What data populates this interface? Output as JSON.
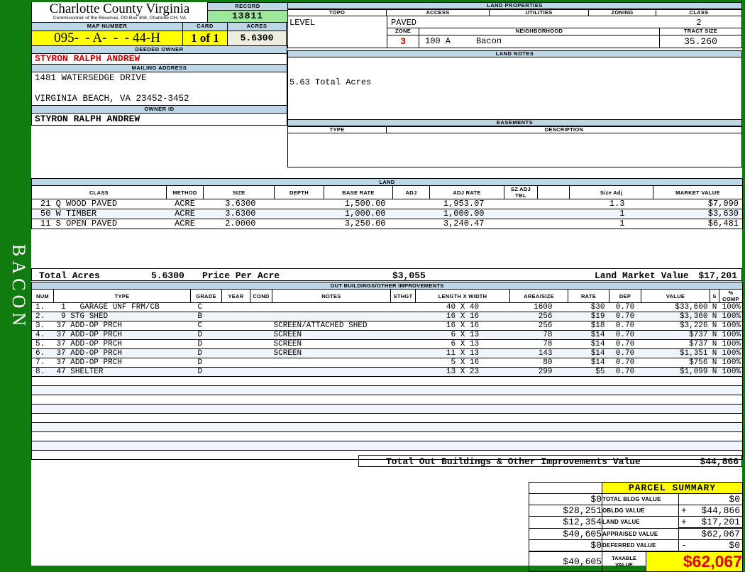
{
  "sidebar": {
    "label": "BACON"
  },
  "header": {
    "county": "Charlotte County Virginia",
    "commissioner": "Commissioner of the Revenue, PO Box 308, Charlotte CH, VA",
    "record_label": "RECORD",
    "record_value": "13811",
    "map_number_label": "MAP NUMBER",
    "map_number": "095-  - A-  -  - 44-H",
    "card_label": "CARD",
    "card": "1 of 1",
    "acres_label": "ACRES",
    "acres": "5.6300"
  },
  "owner": {
    "deeded_owner_label": "DEEDED OWNER",
    "deeded_owner": "STYRON RALPH ANDREW",
    "mailing_address_label": "MAILING ADDRESS",
    "address_line1": "1481 WATERSEDGE DRIVE",
    "address_line2": "VIRGINIA BEACH, VA 23452-3452",
    "owner_id_label": "OWNER ID",
    "owner_id": "STYRON RALPH ANDREW"
  },
  "land_properties": {
    "title": "LAND PROPERTIES",
    "topo_label": "TOPO",
    "topo": "LEVEL",
    "access_label": "ACCESS",
    "access": "PAVED",
    "utilities_label": "UTILITIES",
    "zoning_label": "ZONING",
    "class_label": "CLASS",
    "class": "2",
    "zone_label": "ZONE",
    "zone": "3",
    "neighborhood_label": "NEIGHBORHOOD",
    "neighborhood": "100 A     Bacon",
    "tract_size_label": "TRACT SIZE",
    "tract_size": "35.260"
  },
  "land_notes": {
    "title": "LAND NOTES",
    "note": "5.63 Total Acres"
  },
  "easements": {
    "title": "EASEMENTS",
    "type_label": "TYPE",
    "description_label": "DESCRIPTION"
  },
  "land": {
    "title": "LAND",
    "headers": [
      "CLASS",
      "METHOD",
      "SIZE",
      "DEPTH",
      "BASE RATE",
      "ADJ",
      "ADJ RATE",
      "SZ ADJ TBL",
      "",
      "Size Adj",
      "MARKET VALUE"
    ],
    "rows": [
      {
        "class": "21 Q WOOD PAVED",
        "method": "ACRE",
        "size": "3.6300",
        "depth": "",
        "base_rate": "1,500.00",
        "adj": "",
        "adj_rate": "1,953.07",
        "sz_adj_tbl": "",
        "blank": "",
        "size_adj": "1.3",
        "market_value": "$7,090"
      },
      {
        "class": "50 W TIMBER",
        "method": "ACRE",
        "size": "3.6300",
        "depth": "",
        "base_rate": "1,000.00",
        "adj": "",
        "adj_rate": "1,000.00",
        "sz_adj_tbl": "",
        "blank": "",
        "size_adj": "1",
        "market_value": "$3,630"
      },
      {
        "class": "11 S OPEN PAVED",
        "method": "ACRE",
        "size": "2.0000",
        "depth": "",
        "base_rate": "3,250.00",
        "adj": "",
        "adj_rate": "3,240.47",
        "sz_adj_tbl": "",
        "blank": "",
        "size_adj": "1",
        "market_value": "$6,481"
      }
    ],
    "total_acres_label": "Total Acres",
    "total_acres": "5.6300",
    "price_per_acre_label": "Price Per Acre",
    "price_per_acre": "$3,055",
    "market_value_label": "Land Market Value",
    "market_value": "$17,201"
  },
  "out_buildings": {
    "title": "OUT BUILDINGS/OTHER IMPROVEMENTS",
    "headers": [
      "NUM",
      "TYPE",
      "GRADE",
      "YEAR",
      "COND",
      "NOTES",
      "STHGT",
      "LENGTH X WIDTH",
      "AREA/SIZE",
      "RATE",
      "DEP",
      "VALUE",
      "S",
      "% COMP"
    ],
    "rows": [
      {
        "num": "1.",
        "type": " 1   GARAGE UNF FRM/CB",
        "grade": "C",
        "year": "",
        "cond": "",
        "notes": "",
        "sthgt": "",
        "lxw": "40 X 40",
        "area": "1600",
        "rate": "$30",
        "dep": "0.70",
        "value": "$33,600",
        "s": "N",
        "comp": "100%"
      },
      {
        "num": "2.",
        "type": " 9 STG SHED",
        "grade": "B",
        "year": "",
        "cond": "",
        "notes": "",
        "sthgt": "",
        "lxw": "16 X 16",
        "area": "256",
        "rate": "$19",
        "dep": "0.70",
        "value": "$3,360",
        "s": "N",
        "comp": "100%"
      },
      {
        "num": "3.",
        "type": "37 ADD-OP PRCH",
        "grade": "C",
        "year": "",
        "cond": "",
        "notes": "SCREEN/ATTACHED SHED",
        "sthgt": "",
        "lxw": "16 X 16",
        "area": "256",
        "rate": "$18",
        "dep": "0.70",
        "value": "$3,226",
        "s": "N",
        "comp": "100%"
      },
      {
        "num": "4.",
        "type": "37 ADD-OP PRCH",
        "grade": "D",
        "year": "",
        "cond": "",
        "notes": "SCREEN",
        "sthgt": "",
        "lxw": " 6 X 13",
        "area": "78",
        "rate": "$14",
        "dep": "0.70",
        "value": "$737",
        "s": "N",
        "comp": "100%"
      },
      {
        "num": "5.",
        "type": "37 ADD-OP PRCH",
        "grade": "D",
        "year": "",
        "cond": "",
        "notes": "SCREEN",
        "sthgt": "",
        "lxw": " 6 X 13",
        "area": "78",
        "rate": "$14",
        "dep": "0.70",
        "value": "$737",
        "s": "N",
        "comp": "100%"
      },
      {
        "num": "6.",
        "type": "37 ADD-OP PRCH",
        "grade": "D",
        "year": "",
        "cond": "",
        "notes": "SCREEN",
        "sthgt": "",
        "lxw": "11 X 13",
        "area": "143",
        "rate": "$14",
        "dep": "0.70",
        "value": "$1,351",
        "s": "N",
        "comp": "100%"
      },
      {
        "num": "7.",
        "type": "37 ADD-OP PRCH",
        "grade": "D",
        "year": "",
        "cond": "",
        "notes": "",
        "sthgt": "",
        "lxw": " 5 X 16",
        "area": "80",
        "rate": "$14",
        "dep": "0.70",
        "value": "$756",
        "s": "N",
        "comp": "100%"
      },
      {
        "num": "8.",
        "type": "47 SHELTER",
        "grade": "D",
        "year": "",
        "cond": "",
        "notes": "",
        "sthgt": "",
        "lxw": "13 X 23",
        "area": "299",
        "rate": "$5",
        "dep": "0.70",
        "value": "$1,099",
        "s": "N",
        "comp": "100%"
      }
    ],
    "total_label": "Total Out Buildings & Other Improvements Value",
    "total_value": "$44,866"
  },
  "parcel_summary": {
    "title": "PARCEL SUMMARY",
    "rows": [
      {
        "prev": "$0",
        "label": "TOTAL BLDG VALUE",
        "sign": "",
        "value": "$0"
      },
      {
        "prev": "$28,251",
        "label": "OBLDG VALUE",
        "sign": "+",
        "value": "$44,866"
      },
      {
        "prev": "$12,354",
        "label": "LAND VALUE",
        "sign": "+",
        "value": "$17,201"
      },
      {
        "prev": "$40,605",
        "label": "APPRAISED VALUE",
        "sign": "",
        "value": "$62,067"
      },
      {
        "prev": "$0",
        "label": "DEFERRED VALUE",
        "sign": "-",
        "value": "$0"
      }
    ],
    "taxable": {
      "prev": "$40,605",
      "label": "TAXABLE VALUE",
      "value": "$62,067"
    }
  },
  "colors": {
    "page_background": "#107C10",
    "section_header": "#BDD7E7",
    "record_highlight": "#9BE89B",
    "map_highlight": "#FFFF00",
    "acres_highlight": "#EEEEDF",
    "owner_red": "#CC0000",
    "taxable_red": "#E60000",
    "row_stripe": "#F0F4FB"
  }
}
